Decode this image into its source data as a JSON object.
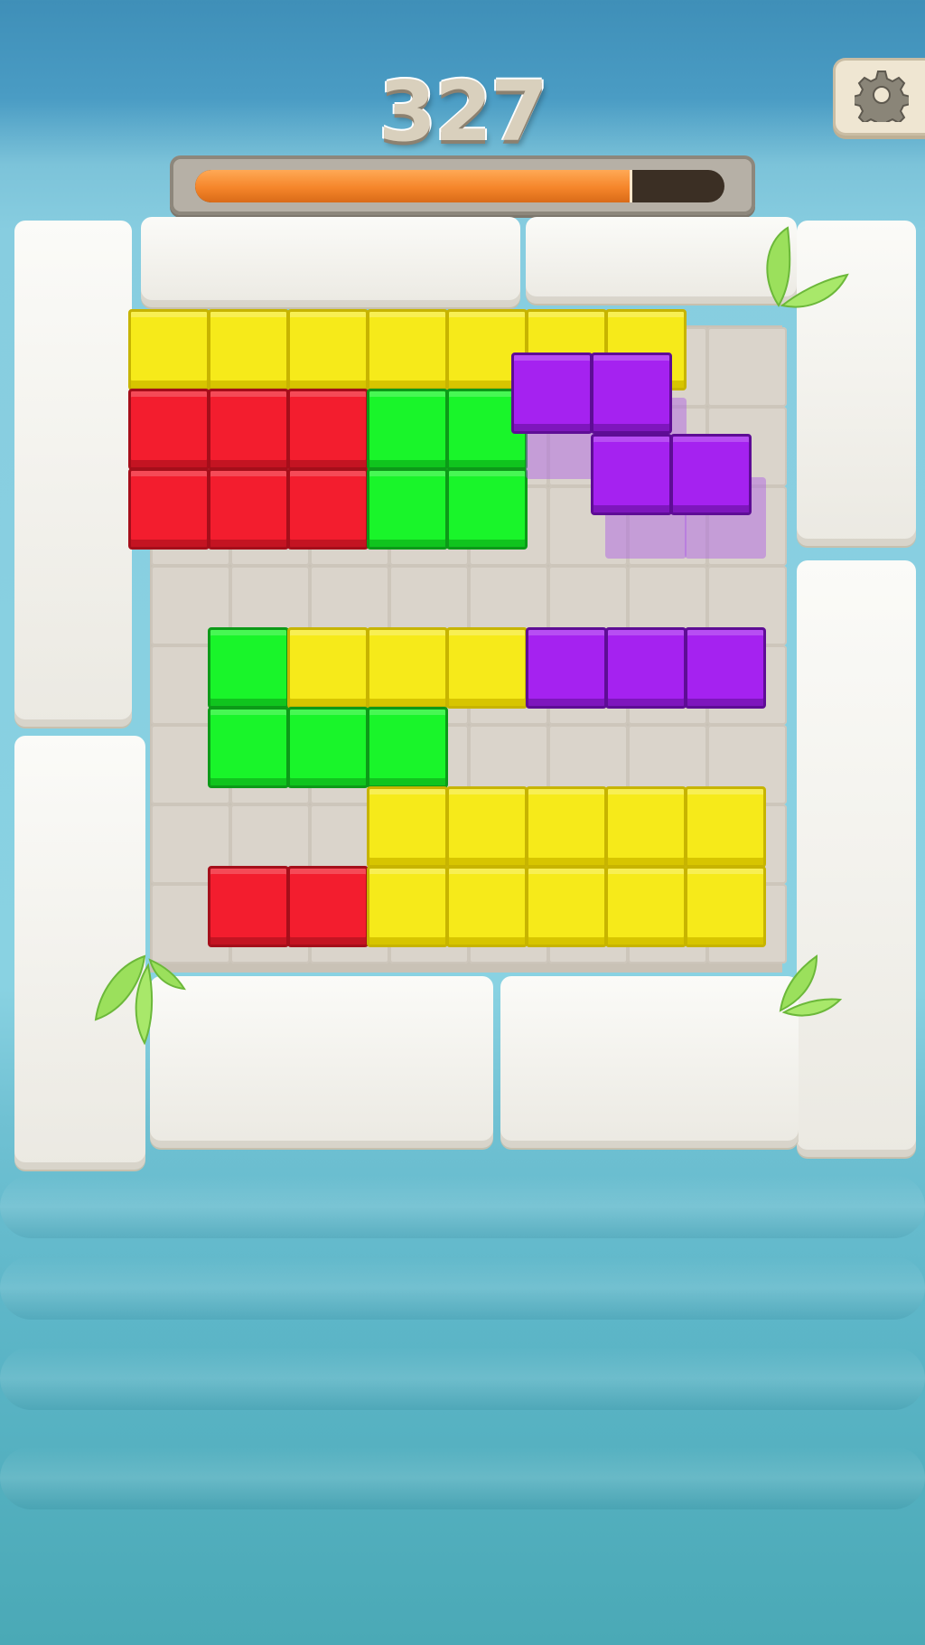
{
  "hud": {
    "score": "327",
    "progress": 0.82,
    "settings_icon": "gear-icon"
  },
  "board": {
    "cols": 8,
    "rows": 8,
    "colors": {
      "yellow": "#f6ea1a",
      "red": "#f31d2e",
      "green": "#19f52a",
      "purple": "#a522f0",
      "empty": "#dad4cb"
    },
    "placed_blocks": [
      {
        "row": 0,
        "col": 0,
        "color": "yellow"
      },
      {
        "row": 0,
        "col": 1,
        "color": "yellow"
      },
      {
        "row": 0,
        "col": 2,
        "color": "yellow"
      },
      {
        "row": 0,
        "col": 3,
        "color": "yellow"
      },
      {
        "row": 0,
        "col": 4,
        "color": "yellow"
      },
      {
        "row": 0,
        "col": 5,
        "color": "yellow"
      },
      {
        "row": 0,
        "col": 6,
        "color": "yellow"
      },
      {
        "row": 1,
        "col": 0,
        "color": "red"
      },
      {
        "row": 1,
        "col": 1,
        "color": "red"
      },
      {
        "row": 1,
        "col": 2,
        "color": "red"
      },
      {
        "row": 1,
        "col": 3,
        "color": "green"
      },
      {
        "row": 1,
        "col": 4,
        "color": "green"
      },
      {
        "row": 2,
        "col": 0,
        "color": "red"
      },
      {
        "row": 2,
        "col": 1,
        "color": "red"
      },
      {
        "row": 2,
        "col": 2,
        "color": "red"
      },
      {
        "row": 2,
        "col": 3,
        "color": "green"
      },
      {
        "row": 2,
        "col": 4,
        "color": "green"
      },
      {
        "row": 4,
        "col": 1,
        "color": "green"
      },
      {
        "row": 4,
        "col": 2,
        "color": "yellow"
      },
      {
        "row": 4,
        "col": 3,
        "color": "yellow"
      },
      {
        "row": 4,
        "col": 4,
        "color": "yellow"
      },
      {
        "row": 4,
        "col": 5,
        "color": "purple"
      },
      {
        "row": 4,
        "col": 6,
        "color": "purple"
      },
      {
        "row": 4,
        "col": 7,
        "color": "purple"
      },
      {
        "row": 5,
        "col": 1,
        "color": "green"
      },
      {
        "row": 5,
        "col": 2,
        "color": "green"
      },
      {
        "row": 5,
        "col": 3,
        "color": "green"
      },
      {
        "row": 6,
        "col": 3,
        "color": "yellow"
      },
      {
        "row": 6,
        "col": 4,
        "color": "yellow"
      },
      {
        "row": 6,
        "col": 5,
        "color": "yellow"
      },
      {
        "row": 6,
        "col": 6,
        "color": "yellow"
      },
      {
        "row": 6,
        "col": 7,
        "color": "yellow"
      },
      {
        "row": 7,
        "col": 1,
        "color": "red"
      },
      {
        "row": 7,
        "col": 2,
        "color": "red"
      },
      {
        "row": 7,
        "col": 3,
        "color": "yellow"
      },
      {
        "row": 7,
        "col": 4,
        "color": "yellow"
      },
      {
        "row": 7,
        "col": 5,
        "color": "yellow"
      },
      {
        "row": 7,
        "col": 6,
        "color": "yellow"
      },
      {
        "row": 7,
        "col": 7,
        "color": "yellow"
      }
    ],
    "dragged_piece": {
      "color": "purple",
      "shape": "Z",
      "cells": [
        [
          0,
          0
        ],
        [
          0,
          1
        ],
        [
          1,
          1
        ],
        [
          1,
          2
        ]
      ]
    },
    "drop_preview": {
      "color": "purple",
      "cells": [
        [
          1,
          5
        ],
        [
          1,
          6
        ],
        [
          2,
          6
        ],
        [
          2,
          7
        ]
      ]
    }
  }
}
